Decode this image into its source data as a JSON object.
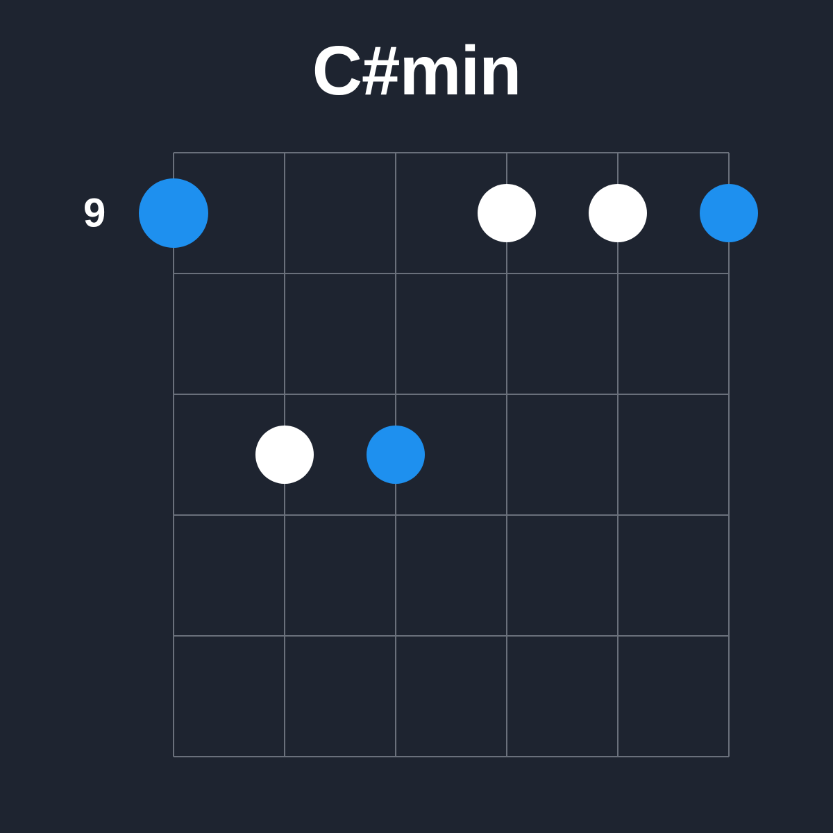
{
  "chord": {
    "name": "C#min",
    "starting_fret_label": "9",
    "starting_fret": 9,
    "num_frets": 5,
    "num_strings": 6,
    "colors": {
      "background": "#1e2430",
      "grid": "#6a707b",
      "text": "#ffffff",
      "dot_primary": "#ffffff",
      "dot_accent": "#1e90ef"
    },
    "dots": [
      {
        "string": 1,
        "fret": 1,
        "color": "blue",
        "size": "large"
      },
      {
        "string": 4,
        "fret": 1,
        "color": "white",
        "size": "small"
      },
      {
        "string": 5,
        "fret": 1,
        "color": "white",
        "size": "small"
      },
      {
        "string": 6,
        "fret": 1,
        "color": "blue",
        "size": "small"
      },
      {
        "string": 2,
        "fret": 3,
        "color": "white",
        "size": "small"
      },
      {
        "string": 3,
        "fret": 3,
        "color": "blue",
        "size": "small"
      }
    ]
  }
}
